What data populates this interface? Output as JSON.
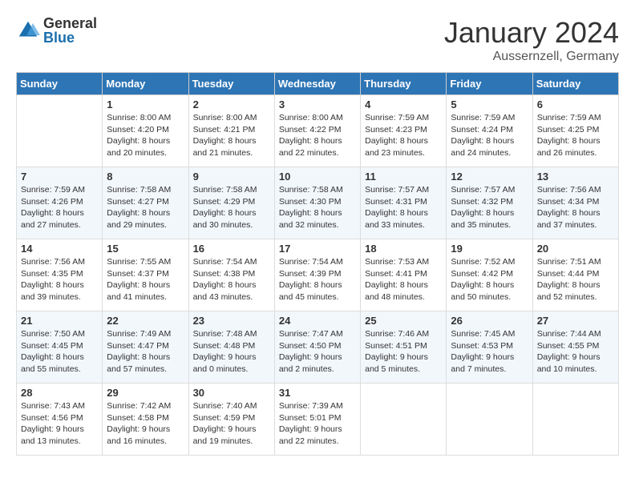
{
  "header": {
    "logo_general": "General",
    "logo_blue": "Blue",
    "month_title": "January 2024",
    "location": "Aussernzell, Germany"
  },
  "weekdays": [
    "Sunday",
    "Monday",
    "Tuesday",
    "Wednesday",
    "Thursday",
    "Friday",
    "Saturday"
  ],
  "weeks": [
    [
      {
        "day": "",
        "info": ""
      },
      {
        "day": "1",
        "info": "Sunrise: 8:00 AM\nSunset: 4:20 PM\nDaylight: 8 hours\nand 20 minutes."
      },
      {
        "day": "2",
        "info": "Sunrise: 8:00 AM\nSunset: 4:21 PM\nDaylight: 8 hours\nand 21 minutes."
      },
      {
        "day": "3",
        "info": "Sunrise: 8:00 AM\nSunset: 4:22 PM\nDaylight: 8 hours\nand 22 minutes."
      },
      {
        "day": "4",
        "info": "Sunrise: 7:59 AM\nSunset: 4:23 PM\nDaylight: 8 hours\nand 23 minutes."
      },
      {
        "day": "5",
        "info": "Sunrise: 7:59 AM\nSunset: 4:24 PM\nDaylight: 8 hours\nand 24 minutes."
      },
      {
        "day": "6",
        "info": "Sunrise: 7:59 AM\nSunset: 4:25 PM\nDaylight: 8 hours\nand 26 minutes."
      }
    ],
    [
      {
        "day": "7",
        "info": "Sunrise: 7:59 AM\nSunset: 4:26 PM\nDaylight: 8 hours\nand 27 minutes."
      },
      {
        "day": "8",
        "info": "Sunrise: 7:58 AM\nSunset: 4:27 PM\nDaylight: 8 hours\nand 29 minutes."
      },
      {
        "day": "9",
        "info": "Sunrise: 7:58 AM\nSunset: 4:29 PM\nDaylight: 8 hours\nand 30 minutes."
      },
      {
        "day": "10",
        "info": "Sunrise: 7:58 AM\nSunset: 4:30 PM\nDaylight: 8 hours\nand 32 minutes."
      },
      {
        "day": "11",
        "info": "Sunrise: 7:57 AM\nSunset: 4:31 PM\nDaylight: 8 hours\nand 33 minutes."
      },
      {
        "day": "12",
        "info": "Sunrise: 7:57 AM\nSunset: 4:32 PM\nDaylight: 8 hours\nand 35 minutes."
      },
      {
        "day": "13",
        "info": "Sunrise: 7:56 AM\nSunset: 4:34 PM\nDaylight: 8 hours\nand 37 minutes."
      }
    ],
    [
      {
        "day": "14",
        "info": "Sunrise: 7:56 AM\nSunset: 4:35 PM\nDaylight: 8 hours\nand 39 minutes."
      },
      {
        "day": "15",
        "info": "Sunrise: 7:55 AM\nSunset: 4:37 PM\nDaylight: 8 hours\nand 41 minutes."
      },
      {
        "day": "16",
        "info": "Sunrise: 7:54 AM\nSunset: 4:38 PM\nDaylight: 8 hours\nand 43 minutes."
      },
      {
        "day": "17",
        "info": "Sunrise: 7:54 AM\nSunset: 4:39 PM\nDaylight: 8 hours\nand 45 minutes."
      },
      {
        "day": "18",
        "info": "Sunrise: 7:53 AM\nSunset: 4:41 PM\nDaylight: 8 hours\nand 48 minutes."
      },
      {
        "day": "19",
        "info": "Sunrise: 7:52 AM\nSunset: 4:42 PM\nDaylight: 8 hours\nand 50 minutes."
      },
      {
        "day": "20",
        "info": "Sunrise: 7:51 AM\nSunset: 4:44 PM\nDaylight: 8 hours\nand 52 minutes."
      }
    ],
    [
      {
        "day": "21",
        "info": "Sunrise: 7:50 AM\nSunset: 4:45 PM\nDaylight: 8 hours\nand 55 minutes."
      },
      {
        "day": "22",
        "info": "Sunrise: 7:49 AM\nSunset: 4:47 PM\nDaylight: 8 hours\nand 57 minutes."
      },
      {
        "day": "23",
        "info": "Sunrise: 7:48 AM\nSunset: 4:48 PM\nDaylight: 9 hours\nand 0 minutes."
      },
      {
        "day": "24",
        "info": "Sunrise: 7:47 AM\nSunset: 4:50 PM\nDaylight: 9 hours\nand 2 minutes."
      },
      {
        "day": "25",
        "info": "Sunrise: 7:46 AM\nSunset: 4:51 PM\nDaylight: 9 hours\nand 5 minutes."
      },
      {
        "day": "26",
        "info": "Sunrise: 7:45 AM\nSunset: 4:53 PM\nDaylight: 9 hours\nand 7 minutes."
      },
      {
        "day": "27",
        "info": "Sunrise: 7:44 AM\nSunset: 4:55 PM\nDaylight: 9 hours\nand 10 minutes."
      }
    ],
    [
      {
        "day": "28",
        "info": "Sunrise: 7:43 AM\nSunset: 4:56 PM\nDaylight: 9 hours\nand 13 minutes."
      },
      {
        "day": "29",
        "info": "Sunrise: 7:42 AM\nSunset: 4:58 PM\nDaylight: 9 hours\nand 16 minutes."
      },
      {
        "day": "30",
        "info": "Sunrise: 7:40 AM\nSunset: 4:59 PM\nDaylight: 9 hours\nand 19 minutes."
      },
      {
        "day": "31",
        "info": "Sunrise: 7:39 AM\nSunset: 5:01 PM\nDaylight: 9 hours\nand 22 minutes."
      },
      {
        "day": "",
        "info": ""
      },
      {
        "day": "",
        "info": ""
      },
      {
        "day": "",
        "info": ""
      }
    ]
  ]
}
